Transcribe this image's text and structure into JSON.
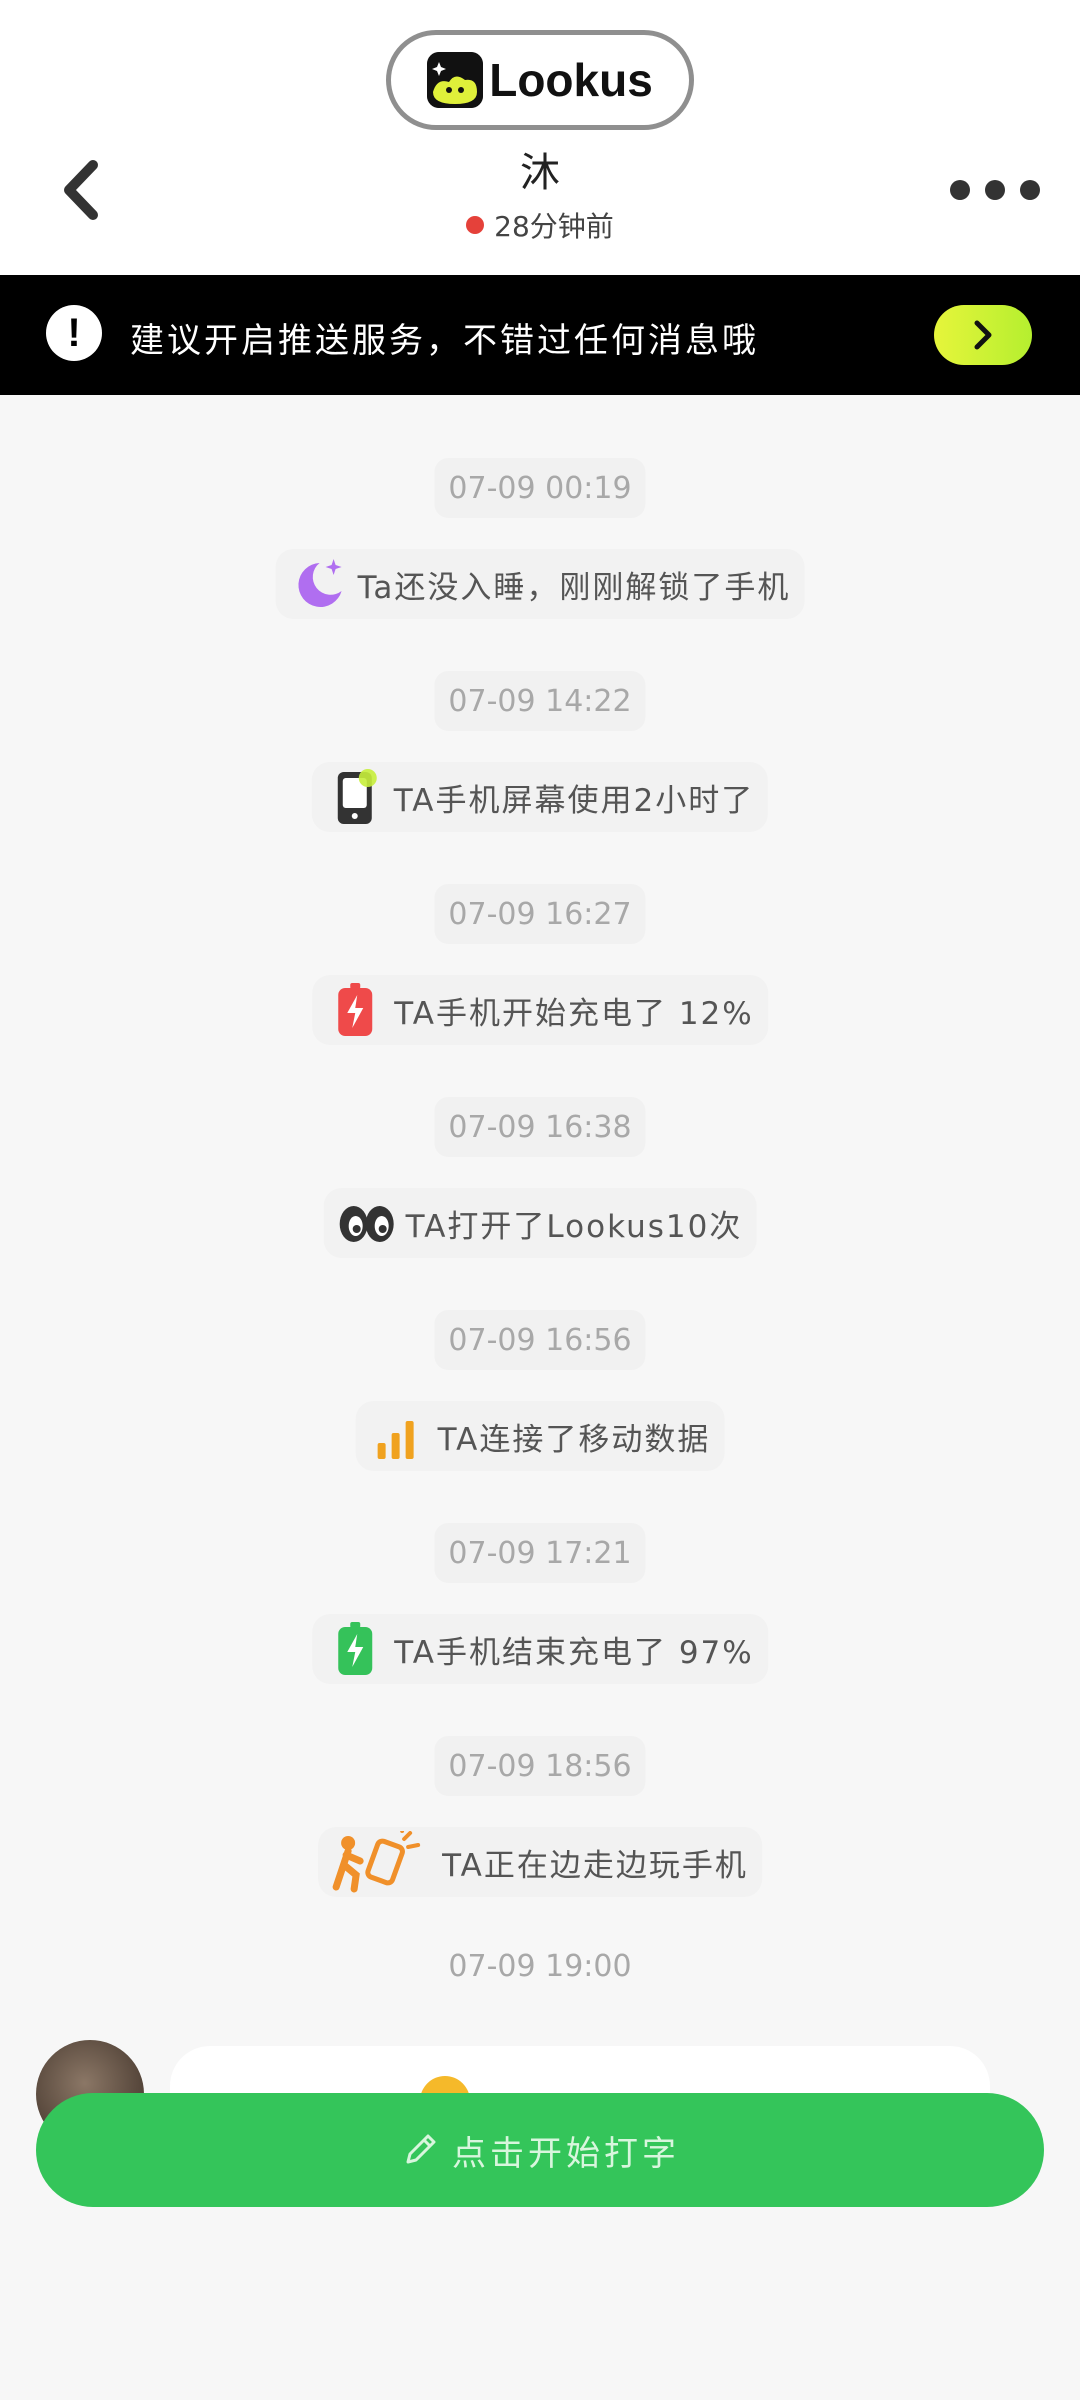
{
  "brand": {
    "name": "Lookus"
  },
  "header": {
    "contact_name": "沐",
    "last_active": "28分钟前"
  },
  "notice": {
    "text": "建议开启推送服务，不错过任何消息哦"
  },
  "timeline": [
    {
      "time": "07-09 00:19",
      "text": "Ta还没入睡，刚刚解锁了手机",
      "icon": "moon-sparkle-icon"
    },
    {
      "time": "07-09 14:22",
      "text": "TA手机屏幕使用2小时了",
      "icon": "phone-screen-icon"
    },
    {
      "time": "07-09 16:27",
      "text": "TA手机开始充电了 12%",
      "icon": "battery-low-charging-icon"
    },
    {
      "time": "07-09 16:38",
      "text": "TA打开了Lookus10次",
      "icon": "eyes-icon"
    },
    {
      "time": "07-09 16:56",
      "text": "TA连接了移动数据",
      "icon": "signal-bars-icon"
    },
    {
      "time": "07-09 17:21",
      "text": "TA手机结束充电了 97%",
      "icon": "battery-full-charging-icon"
    },
    {
      "time": "07-09 18:56",
      "text": "TA正在边走边玩手机",
      "icon": "walking-phone-icon"
    }
  ],
  "last_time": "07-09 19:00",
  "compose": {
    "label": "点击开始打字"
  },
  "colors": {
    "accent_green": "#34c55a",
    "status_red": "#e5413a",
    "notice_button": "#d4f23a"
  }
}
